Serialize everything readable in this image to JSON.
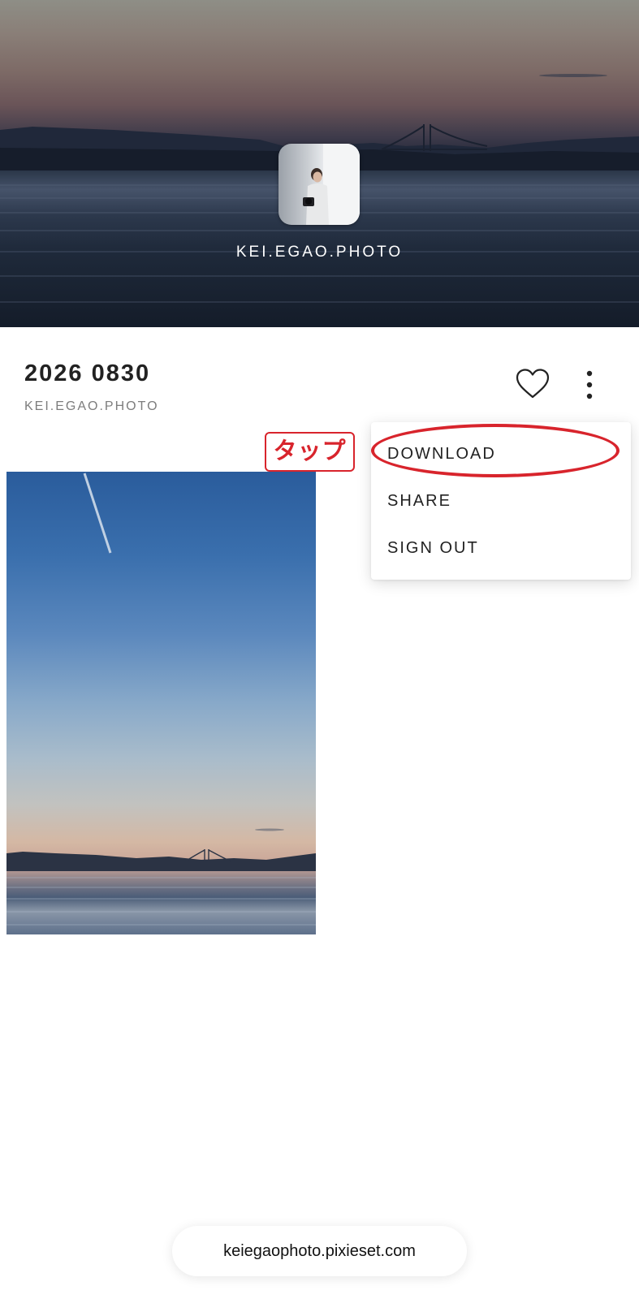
{
  "cover": {
    "title": "KEI.EGAO.PHOTO"
  },
  "gallery": {
    "title": "2026 0830",
    "subtitle": "KEI.EGAO.PHOTO"
  },
  "actions": {
    "favorite_icon": "heart-icon",
    "more_icon": "more-vertical-icon"
  },
  "menu": {
    "items": [
      {
        "label": "DOWNLOAD",
        "highlighted": true
      },
      {
        "label": "SHARE"
      },
      {
        "label": "SIGN OUT"
      }
    ]
  },
  "annotation": {
    "label": "タップ",
    "color": "#d8242c"
  },
  "browser": {
    "url": "keiegaophoto.pixieset.com"
  }
}
